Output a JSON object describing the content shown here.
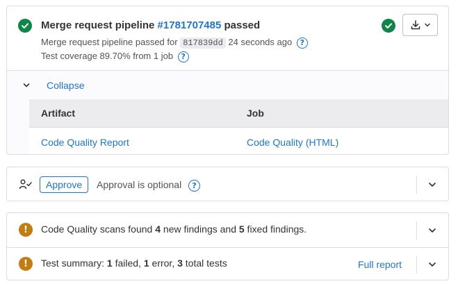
{
  "pipeline": {
    "title_prefix": "Merge request pipeline",
    "pipeline_id": "#1781707485",
    "title_suffix": "passed",
    "passed_for": "Merge request pipeline passed for",
    "commit_sha": "817839dd",
    "time_ago": "24 seconds ago",
    "coverage": "Test coverage 89.70% from 1 job",
    "help_glyph": "?",
    "status_icon": "check-circle-icon",
    "download_icon": "download-icon"
  },
  "artifacts": {
    "collapse_label": "Collapse",
    "header_artifact": "Artifact",
    "header_job": "Job",
    "rows": [
      {
        "artifact": "Code Quality Report",
        "job": "Code Quality (HTML)"
      }
    ]
  },
  "approval": {
    "approve_label": "Approve",
    "status_text": "Approval is optional",
    "help_glyph": "?",
    "approvers_icon": "approval-users-icon"
  },
  "code_quality": {
    "warn_glyph": "!",
    "text_before": "Code Quality scans found ",
    "new_count": "4",
    "text_middle": " new findings and ",
    "fixed_count": "5",
    "text_after": " fixed findings."
  },
  "test_summary": {
    "warn_glyph": "!",
    "label": "Test summary: ",
    "failed_count": "1",
    "failed_text": " failed, ",
    "error_count": "1",
    "error_text": " error, ",
    "total_count": "3",
    "total_text": " total tests",
    "full_report_label": "Full report"
  },
  "colors": {
    "success": "#108548",
    "warning": "#c17d10",
    "link": "#1f75cb",
    "border": "#dcdcde"
  }
}
